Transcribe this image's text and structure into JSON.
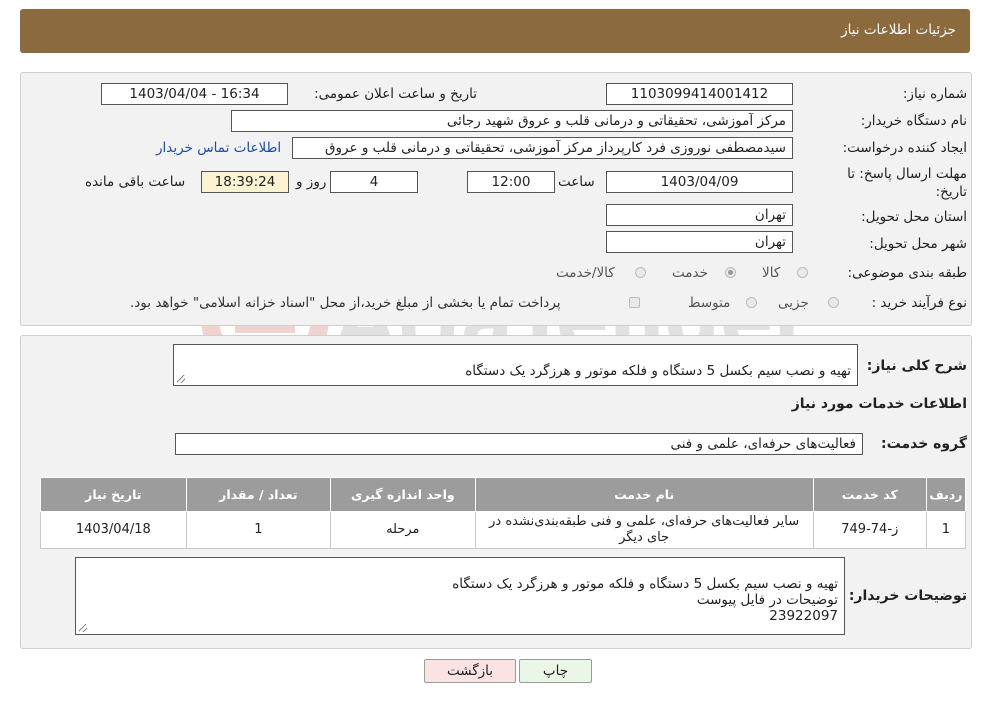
{
  "header": {
    "title": "جزئیات اطلاعات نیاز"
  },
  "fields": {
    "need_number_label": "شماره نیاز:",
    "need_number": "1103099414001412",
    "announce_label": "تاریخ و ساعت اعلان عمومی:",
    "announce_value": "1403/04/04 - 16:34",
    "buyer_org_label": "نام دستگاه خریدار:",
    "buyer_org": "مرکز آموزشی، تحقیقاتی و درمانی قلب و عروق شهید رجائی",
    "creator_label": "ایجاد کننده درخواست:",
    "creator": "سیدمصطفی نوروزی فرد کارپرداز مرکز آموزشی، تحقیقاتی و درمانی قلب و عروق",
    "contact_link": "اطلاعات تماس خریدار",
    "deadline_label": "مهلت ارسال پاسخ: تا تاریخ:",
    "deadline_date": "1403/04/09",
    "time_label": "ساعت",
    "deadline_time": "12:00",
    "days_value": "4",
    "days_label": "روز و",
    "remaining_time": "18:39:24",
    "remaining_label": "ساعت باقی مانده",
    "province_label": "استان محل تحویل:",
    "province": "تهران",
    "city_label": "شهر محل تحویل:",
    "city": "تهران",
    "category_label": "طبقه بندی موضوعی:",
    "category_options": [
      "کالا",
      "خدمت",
      "کالا/خدمت"
    ],
    "category_selected": "خدمت",
    "process_label": "نوع فرآیند خرید :",
    "process_options": [
      "جزیی",
      "متوسط"
    ],
    "payment_note": "پرداخت تمام یا بخشی از مبلغ خرید،از محل \"اسناد خزانه اسلامی\" خواهد بود."
  },
  "description": {
    "label": "شرح کلی نیاز:",
    "text": "تهیه و نصب سیم بکسل 5 دستگاه و فلکه موتور و هرزگرد یک دستگاه"
  },
  "services": {
    "section_title": "اطلاعات خدمات مورد نیاز",
    "group_label": "گروه خدمت:",
    "group_value": "فعالیت‌های حرفه‌ای، علمی و فنی",
    "table": {
      "headers": [
        "ردیف",
        "کد خدمت",
        "نام خدمت",
        "واحد اندازه گیری",
        "تعداد / مقدار",
        "تاریخ نیاز"
      ],
      "rows": [
        [
          "1",
          "ز-74-749",
          "سایر فعالیت‌های حرفه‌ای، علمی و فنی طبقه‌بندی‌نشده در جای دیگر",
          "مرحله",
          "1",
          "1403/04/18"
        ]
      ]
    }
  },
  "buyer_notes": {
    "label": "توضیحات خریدار:",
    "text": "تهیه و نصب سیم بکسل 5 دستگاه و فلکه موتور و هرزگرد یک دستگاه\nتوضیحات در فایل پیوست\n23922097"
  },
  "buttons": {
    "print": "چاپ",
    "back": "بازگشت"
  },
  "watermark_text": "AriaTender.neT",
  "colors": {
    "header_bg": "#8b6a3e",
    "panel_bg": "#f2f2f2",
    "table_header_bg": "#9c9c9c",
    "print_btn_bg": "#eaf7e6",
    "back_btn_bg": "#fbe3e3",
    "link": "#1a4ea8"
  }
}
